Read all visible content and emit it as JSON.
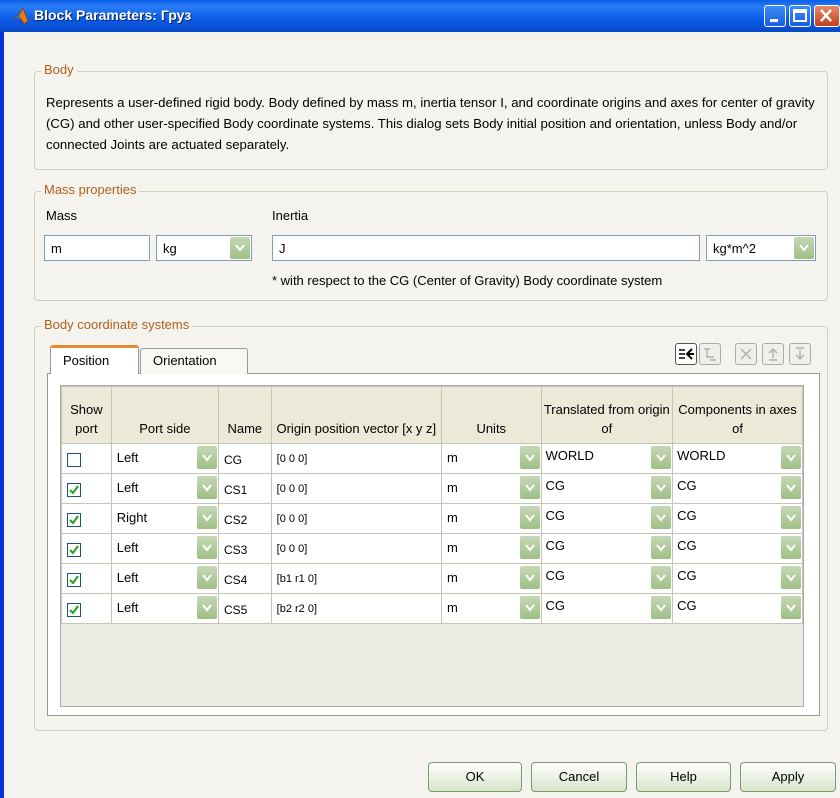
{
  "window": {
    "title": "Block Parameters: Груз"
  },
  "body_group": {
    "legend": "Body",
    "description": "Represents a user-defined rigid body. Body defined by mass m, inertia tensor I, and coordinate origins and axes for center of gravity (CG) and other user-specified Body coordinate systems. This dialog sets Body initial position and orientation, unless Body and/or connected Joints are actuated separately."
  },
  "mass_group": {
    "legend": "Mass properties",
    "mass_label": "Mass",
    "mass_value": "m",
    "mass_unit": "kg",
    "inertia_label": "Inertia",
    "inertia_value": "J",
    "inertia_unit": "kg*m^2",
    "note": "* with respect to the CG (Center of Gravity) Body coordinate system"
  },
  "coords_group": {
    "legend": "Body coordinate systems",
    "tabs": [
      {
        "label": "Position"
      },
      {
        "label": "Orientation"
      }
    ],
    "headers": {
      "show_port": "Show port",
      "port_side": "Port side",
      "name": "Name",
      "origin": "Origin position vector [x y z]",
      "units": "Units",
      "translated": "Translated from origin of",
      "components": "Components in axes of"
    },
    "rows": [
      {
        "checked": false,
        "port_side": "Left",
        "name": "CG",
        "origin": "[0 0 0]",
        "units": "m",
        "translated": "WORLD",
        "components": "WORLD"
      },
      {
        "checked": true,
        "port_side": "Left",
        "name": "CS1",
        "origin": "[0 0 0]",
        "units": "m",
        "translated": "CG",
        "components": "CG"
      },
      {
        "checked": true,
        "port_side": "Right",
        "name": "CS2",
        "origin": "[0 0 0]",
        "units": "m",
        "translated": "CG",
        "components": "CG"
      },
      {
        "checked": true,
        "port_side": "Left",
        "name": "CS3",
        "origin": "[0 0 0]",
        "units": "m",
        "translated": "CG",
        "components": "CG"
      },
      {
        "checked": true,
        "port_side": "Left",
        "name": "CS4",
        "origin": "[b1 r1 0]",
        "units": "m",
        "translated": "CG",
        "components": "CG"
      },
      {
        "checked": true,
        "port_side": "Left",
        "name": "CS5",
        "origin": "[b2 r2 0]",
        "units": "m",
        "translated": "CG",
        "components": "CG"
      }
    ]
  },
  "buttons": {
    "ok": "OK",
    "cancel": "Cancel",
    "help": "Help",
    "apply": "Apply"
  },
  "colors": {
    "titlebar": "#0a5fe8",
    "legend": "#b35f1d",
    "combo_arrow": "#9fbf85"
  }
}
